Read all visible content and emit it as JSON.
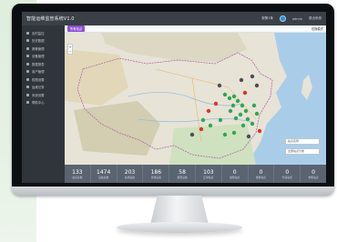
{
  "app": {
    "title": "智能运维监管系统V1.0"
  },
  "header": {
    "alarm_text": "报警1条",
    "user_name": "admin",
    "logout_text": "退出系统"
  },
  "sidebar": {
    "items": [
      {
        "label": "实时监控"
      },
      {
        "label": "历史数据"
      },
      {
        "label": "报警管理"
      },
      {
        "label": "设备管理"
      },
      {
        "label": "数据报表"
      },
      {
        "label": "用户管理"
      },
      {
        "label": "权限设置"
      },
      {
        "label": "运维记录"
      },
      {
        "label": "系统设置"
      },
      {
        "label": "帮助中心"
      }
    ]
  },
  "toolbar": {
    "chip_label": "所有站点",
    "right_label": "切换模式"
  },
  "map_panels": {
    "search_placeholder": "站点名称",
    "filter_placeholder": "全部站点分类"
  },
  "stats": [
    {
      "value": "133",
      "label": "站点总数"
    },
    {
      "value": "1474",
      "label": "设备总数"
    },
    {
      "value": "203",
      "label": "在线设备"
    },
    {
      "value": "186",
      "label": "离线设备"
    },
    {
      "value": "58",
      "label": "报警设备"
    },
    {
      "value": "103",
      "label": "正常站点"
    },
    {
      "value": "0",
      "label": "故障站点"
    },
    {
      "value": "0",
      "label": "维修站点"
    },
    {
      "value": "0",
      "label": "停运站点"
    },
    {
      "value": "0",
      "label": "未知站点"
    }
  ],
  "colors": {
    "accent": "#8d4fd3",
    "marker_green": "#2fa84f",
    "marker_red": "#d9342b",
    "marker_gray": "#4a4f55"
  }
}
